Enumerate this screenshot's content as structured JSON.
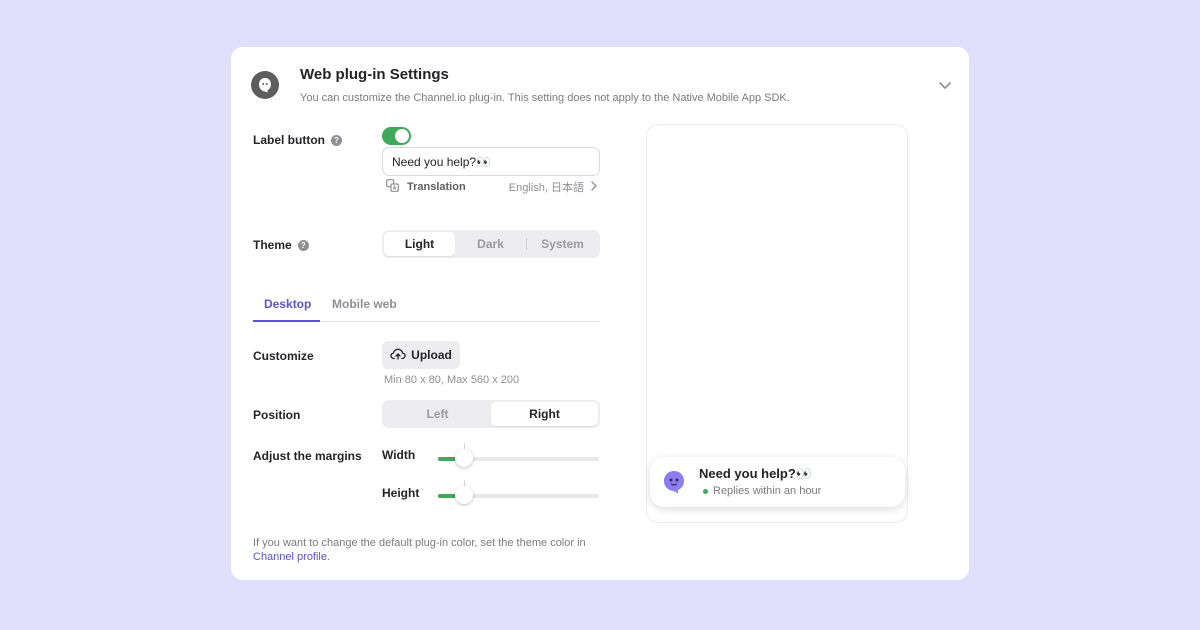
{
  "header": {
    "title": "Web plug-in Settings",
    "subtitle": "You can customize the Channel.io plug-in. This setting does not apply to the Native Mobile App SDK.",
    "app_icon": "channel-ghost-icon",
    "collapse_icon": "chevron-down-icon"
  },
  "label_button": {
    "label": "Label button",
    "enabled": true,
    "text_value": "Need you help?👀",
    "translation_label": "Translation",
    "translation_languages": "English, 日本語"
  },
  "theme": {
    "label": "Theme",
    "options": [
      "Light",
      "Dark",
      "System"
    ],
    "selected": "Light"
  },
  "tabs": {
    "items": [
      "Desktop",
      "Mobile web"
    ],
    "selected": "Desktop"
  },
  "customize": {
    "label": "Customize",
    "upload_label": "Upload",
    "hint": "Min 80 x 80, Max 560 x 200"
  },
  "position": {
    "label": "Position",
    "options": [
      "Left",
      "Right"
    ],
    "selected": "Right"
  },
  "margins": {
    "label": "Adjust the margins",
    "width_label": "Width",
    "height_label": "Height",
    "width_fraction": 0.16,
    "height_fraction": 0.16
  },
  "footnote": {
    "text": "If you want to change the default plug-in color, set the theme color in",
    "link": "Channel profile",
    "suffix": "."
  },
  "preview": {
    "bubble_title": "Need you help?👀",
    "bubble_status": "Replies within an hour",
    "status_color": "#40a85a"
  },
  "colors": {
    "accent": "#5b52d6",
    "toggle_on": "#40a85a",
    "background": "#e0e0fd"
  }
}
